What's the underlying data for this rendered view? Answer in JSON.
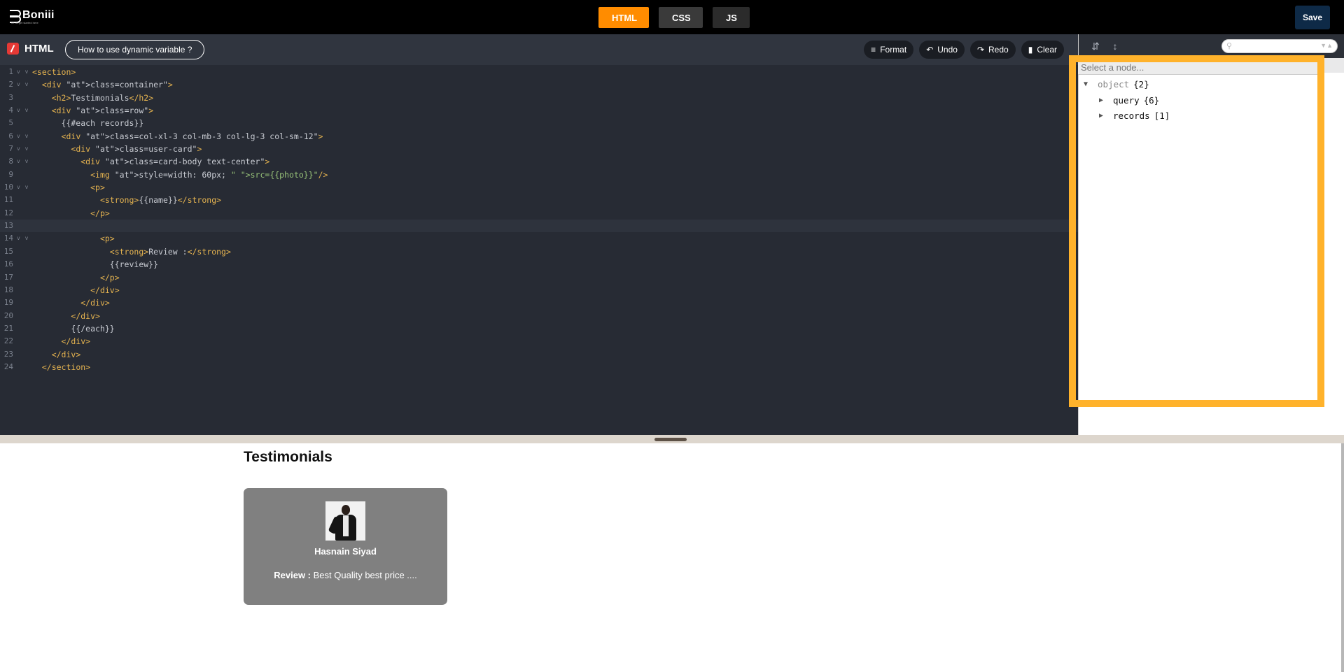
{
  "app": {
    "logo_text": "Boniii",
    "logo_tagline": "let us get started here"
  },
  "lang_tabs": [
    {
      "label": "HTML",
      "active": true
    },
    {
      "label": "CSS",
      "active": false
    },
    {
      "label": "JS",
      "active": false
    }
  ],
  "header": {
    "save_label": "Save"
  },
  "editor": {
    "title": "HTML",
    "help_label": "How to use dynamic variable ?",
    "actions": {
      "format": "Format",
      "undo": "Undo",
      "redo": "Redo",
      "clear": "Clear"
    },
    "code_lines": [
      "<section>",
      "  <div class=\"container\">",
      "    <h2>Testimonials</h2>",
      "    <div class=\"row\">",
      "      {{#each records}}",
      "      <div class=\"col-xl-3 col-mb-3 col-lg-3 col-sm-12\">",
      "        <div class=\"user-card\">",
      "          <div class=\"card-body text-center\">",
      "            <img style=\"width: 60px; \" src=\"{{photo}}\"/>",
      "            <p>",
      "              <strong>{{name}}</strong>",
      "            </p>",
      "",
      "              <p>",
      "                <strong>Review :</strong>",
      "                {{review}}",
      "              </p>",
      "            </div>",
      "          </div>",
      "        </div>",
      "        {{/each}}",
      "      </div>",
      "    </div>",
      "  </section>"
    ],
    "fold_lines": [
      1,
      2,
      4,
      6,
      7,
      8,
      10,
      14
    ],
    "active_line": 13
  },
  "json_panel": {
    "node_placeholder": "Select a node...",
    "tree": [
      {
        "key": "object",
        "count": "{2}",
        "level": 0,
        "expanded": true
      },
      {
        "key": "query",
        "count": "{6}",
        "level": 1,
        "expanded": false
      },
      {
        "key": "records",
        "count": "[1]",
        "level": 1,
        "expanded": false
      }
    ]
  },
  "preview": {
    "heading": "Testimonials",
    "card": {
      "name": "Hasnain Siyad",
      "review_label": "Review :",
      "review_text": "Best Quality best price ...."
    }
  },
  "colors": {
    "accent": "#ff8c00",
    "highlight": "#ffb22b",
    "save_bg": "#0e2a47",
    "editor_bg": "#272b34"
  }
}
